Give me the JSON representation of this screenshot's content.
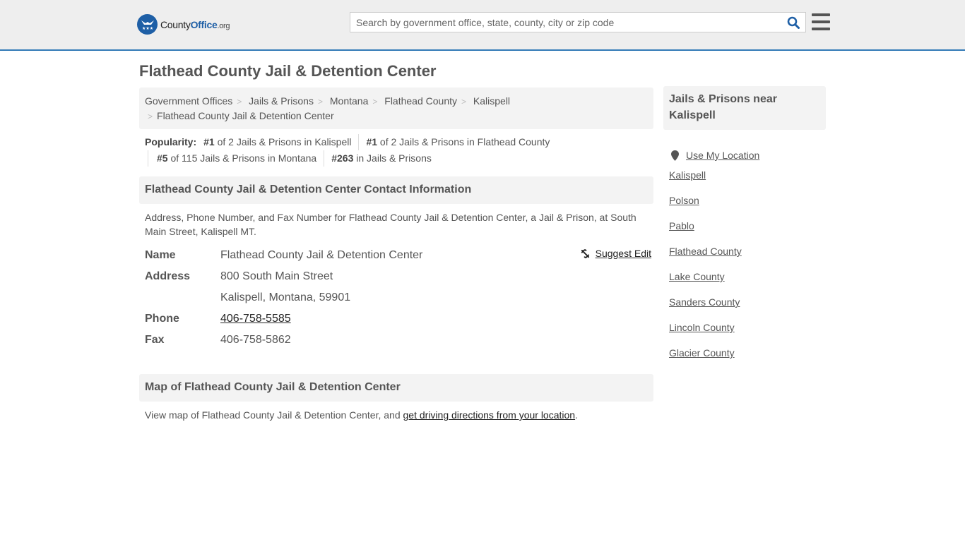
{
  "header": {
    "logo": {
      "county": "County",
      "office": "Office",
      "org": ".org"
    },
    "search_placeholder": "Search by government office, state, county, city or zip code",
    "search_value": ""
  },
  "page_title": "Flathead County Jail & Detention Center",
  "breadcrumb": [
    "Government Offices",
    "Jails & Prisons",
    "Montana",
    "Flathead County",
    "Kalispell",
    "Flathead County Jail & Detention Center"
  ],
  "popularity": {
    "label": "Popularity:",
    "items": [
      {
        "rank": "#1",
        "text": " of 2 Jails & Prisons in Kalispell"
      },
      {
        "rank": "#1",
        "text": " of 2 Jails & Prisons in Flathead County"
      },
      {
        "rank": "#5",
        "text": " of 115 Jails & Prisons in Montana"
      },
      {
        "rank": "#263",
        "text": " in Jails & Prisons"
      }
    ]
  },
  "contact": {
    "heading": "Flathead County Jail & Detention Center Contact Information",
    "description": "Address, Phone Number, and Fax Number for Flathead County Jail & Detention Center, a Jail & Prison, at South Main Street, Kalispell MT.",
    "suggest_edit": "Suggest Edit",
    "rows": {
      "name_label": "Name",
      "name_value": "Flathead County Jail & Detention Center",
      "address_label": "Address",
      "address_line1": "800 South Main Street",
      "address_line2": "Kalispell, Montana, 59901",
      "phone_label": "Phone",
      "phone_value": "406-758-5585",
      "fax_label": "Fax",
      "fax_value": "406-758-5862"
    }
  },
  "map": {
    "heading": "Map of Flathead County Jail & Detention Center",
    "text": "View map of Flathead County Jail & Detention Center, and ",
    "link": "get driving directions from your location",
    "end": "."
  },
  "sidebar": {
    "heading": "Jails & Prisons near Kalispell",
    "use_location": "Use My Location",
    "links": [
      "Kalispell",
      "Polson",
      "Pablo",
      "Flathead County",
      "Lake County",
      "Sanders County",
      "Lincoln County",
      "Glacier County"
    ]
  },
  "colors": {
    "accent": "#337ab7",
    "logo_blue": "#1e5fa6",
    "panel": "#f3f3f3"
  }
}
